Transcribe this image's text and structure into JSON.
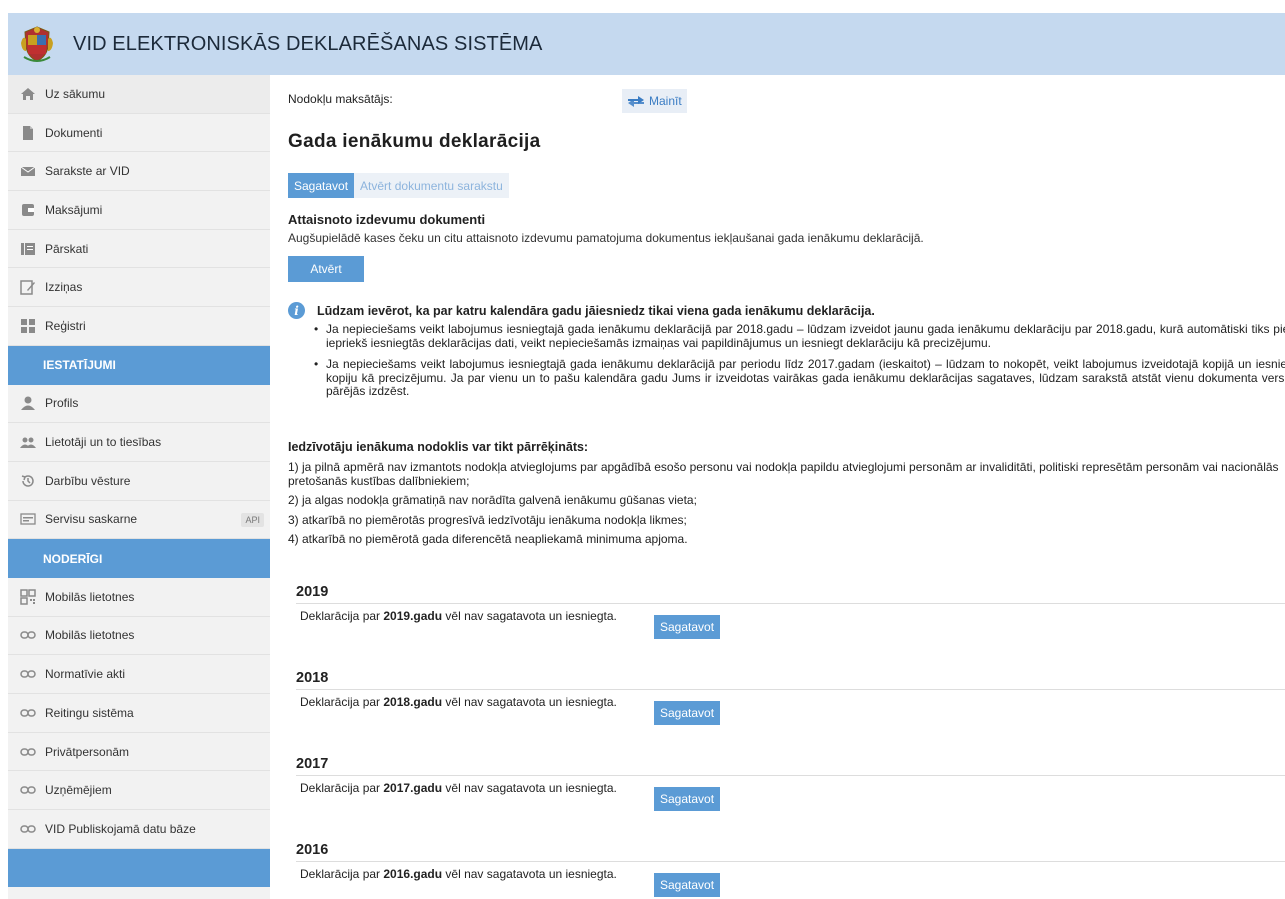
{
  "header": {
    "title": "VID ELEKTRONISKĀS DEKLARĒŠANAS SISTĒMA",
    "logo_icon": "coat-of-arms-icon"
  },
  "sidebar": {
    "items": [
      {
        "label": "Uz sākumu",
        "icon": "home-icon"
      },
      {
        "label": "Dokumenti",
        "icon": "document-icon"
      },
      {
        "label": "Sarakste ar VID",
        "icon": "envelope-icon"
      },
      {
        "label": "Maksājumi",
        "icon": "wallet-icon"
      },
      {
        "label": "Pārskati",
        "icon": "reports-icon"
      },
      {
        "label": "Izziņas",
        "icon": "edit-icon"
      },
      {
        "label": "Reģistri",
        "icon": "grid-icon"
      }
    ],
    "settings_header": "IESTATĪJUMI",
    "settings_items": [
      {
        "label": "Profils",
        "icon": "user-icon"
      },
      {
        "label": "Lietotāji un to tiesības",
        "icon": "users-icon"
      },
      {
        "label": "Darbību vēsture",
        "icon": "history-icon"
      },
      {
        "label": "Servisu saskarne",
        "icon": "api-icon",
        "badge": "API"
      }
    ],
    "useful_header": "NODERĪGI",
    "useful_items": [
      {
        "label": "Mobilās lietotnes",
        "icon": "qr-icon"
      },
      {
        "label": "Mobilās lietotnes",
        "icon": "link-icon"
      },
      {
        "label": "Normatīvie akti",
        "icon": "link-icon"
      },
      {
        "label": "Reitingu sistēma",
        "icon": "link-icon"
      },
      {
        "label": "Privātpersonām",
        "icon": "link-icon"
      },
      {
        "label": "Uzņēmējiem",
        "icon": "link-icon"
      },
      {
        "label": "VID Publiskojamā datu bāze",
        "icon": "link-icon"
      }
    ]
  },
  "main": {
    "taxpayer_label": "Nodokļu maksātājs:",
    "change_button": "Mainīt",
    "page_title": "Gada ienākumu deklarācija",
    "tabs": [
      {
        "label": "Sagatavot",
        "active": true
      },
      {
        "label": "Atvērt dokumentu sarakstu",
        "active": false
      }
    ],
    "expenses": {
      "title": "Attaisnoto izdevumu dokumenti",
      "description": "Augšupielādē kases čeku un citu attaisnoto izdevumu pamatojuma dokumentus iekļaušanai gada ienākumu deklarācijā.",
      "button": "Atvērt"
    },
    "notice": {
      "title": "Lūdzam ievērot, ka par katru kalendāra gadu jāiesniedz tikai viena gada ienākumu deklarācija.",
      "bullets": [
        "Ja nepieciešams veikt labojumus iesniegtajā gada ienākumu deklarācijā par 2018.gadu – lūdzam izveidot jaunu gada ienākumu deklarāciju par 2018.gadu, kurā automātiski tiks pielasīti iepriekš iesniegtās deklarācijas dati, veikt nepieciešamās izmaiņas vai papildinājumus un iesniegt deklarāciju kā precizējumu.",
        "Ja nepieciešams veikt labojumus iesniegtajā gada ienākumu deklarācijā par periodu līdz 2017.gadam (ieskaitot) – lūdzam to nokopēt, veikt labojumus izveidotajā kopijā un iesniegt šo kopiju kā precizējumu. Ja par vienu un to pašu kalendāra gadu Jums ir izveidotas vairākas gada ienākumu deklarācijas sagataves, lūdzam sarakstā atstāt vienu dokumenta versiju un pārējās izdzēst."
      ]
    },
    "recalc": {
      "title": "Iedzīvotāju ienākuma nodoklis var tikt pārrēķināts:",
      "items": [
        "1) ja pilnā apmērā nav izmantots nodokļa atvieglojums par apgādībā esošo personu vai nodokļa papildu atvieglojumi personām ar invaliditāti, politiski represētām personām vai nacionālās pretošanās kustības dalībniekiem;",
        "2) ja algas nodokļa grāmatiņā nav norādīta galvenā ienākumu gūšanas vieta;",
        "3) atkarībā no piemērotās progresīvā iedzīvotāju ienākuma nodokļa likmes;",
        "4) atkarībā no piemērotā gada diferencētā neapliekamā minimuma apjoma."
      ]
    },
    "years": [
      {
        "year": "2019",
        "prefix": "Deklarācija par ",
        "bold": "2019.gadu",
        "suffix": " vēl nav sagatavota un iesniegta.",
        "button": "Sagatavot"
      },
      {
        "year": "2018",
        "prefix": "Deklarācija par ",
        "bold": "2018.gadu",
        "suffix": " vēl nav sagatavota un iesniegta.",
        "button": "Sagatavot"
      },
      {
        "year": "2017",
        "prefix": "Deklarācija par ",
        "bold": "2017.gadu",
        "suffix": " vēl nav sagatavota un iesniegta.",
        "button": "Sagatavot"
      },
      {
        "year": "2016",
        "prefix": "Deklarācija par ",
        "bold": "2016.gadu",
        "suffix": " vēl nav sagatavota un iesniegta.",
        "button": "Sagatavot"
      }
    ]
  },
  "colors": {
    "accent": "#5b9bd5",
    "header_bg": "#c5d9ef",
    "sidebar_bg": "#f2f2f2"
  }
}
